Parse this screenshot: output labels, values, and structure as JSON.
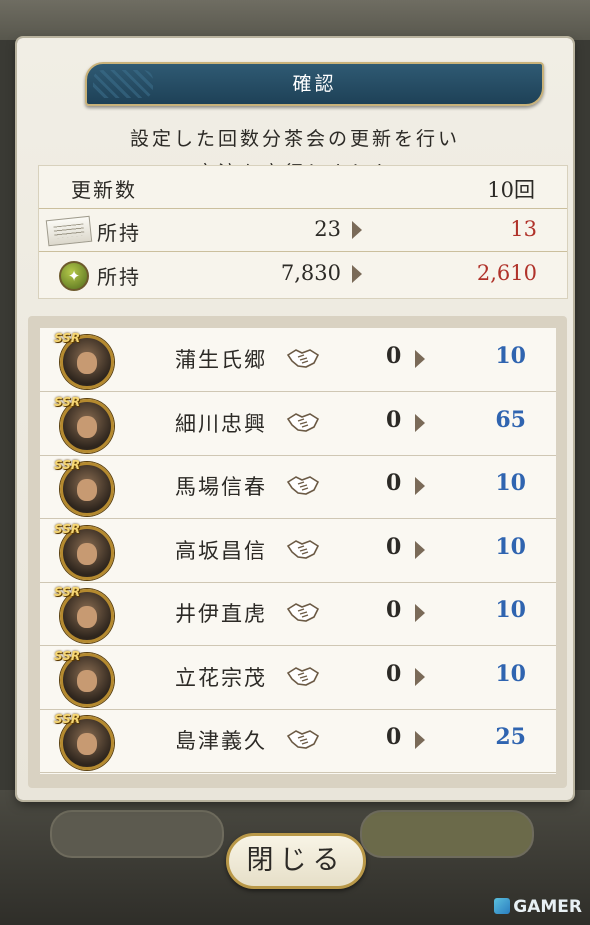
{
  "dialog": {
    "title": "確認",
    "message_line1": "設定した回数分茶会の更新を行い",
    "message_line2": "交流を実行しました",
    "close_label": "閉じる"
  },
  "summary": {
    "update_count_label": "更新数",
    "update_count_value": "10回",
    "items": [
      {
        "icon": "scroll-paper-icon",
        "label": "所持",
        "from": "23",
        "to": "13"
      },
      {
        "icon": "stamina-runner-icon",
        "label": "所持",
        "from": "7,830",
        "to": "2,610"
      }
    ]
  },
  "generals": [
    {
      "rarity": "SSR",
      "name": "蒲生氏郷",
      "from": "0",
      "to": "10"
    },
    {
      "rarity": "SSR",
      "name": "細川忠興",
      "from": "0",
      "to": "65"
    },
    {
      "rarity": "SSR",
      "name": "馬場信春",
      "from": "0",
      "to": "10"
    },
    {
      "rarity": "SSR",
      "name": "高坂昌信",
      "from": "0",
      "to": "10"
    },
    {
      "rarity": "SSR",
      "name": "井伊直虎",
      "from": "0",
      "to": "10"
    },
    {
      "rarity": "SSR",
      "name": "立花宗茂",
      "from": "0",
      "to": "10"
    },
    {
      "rarity": "SSR",
      "name": "島津義久",
      "from": "0",
      "to": "25"
    }
  ],
  "watermark": "GAMER",
  "colors": {
    "title_bar": "#1e4157",
    "increase_red": "#b0322a",
    "increase_blue": "#2f64b0",
    "gold_border": "#b58a2f"
  }
}
